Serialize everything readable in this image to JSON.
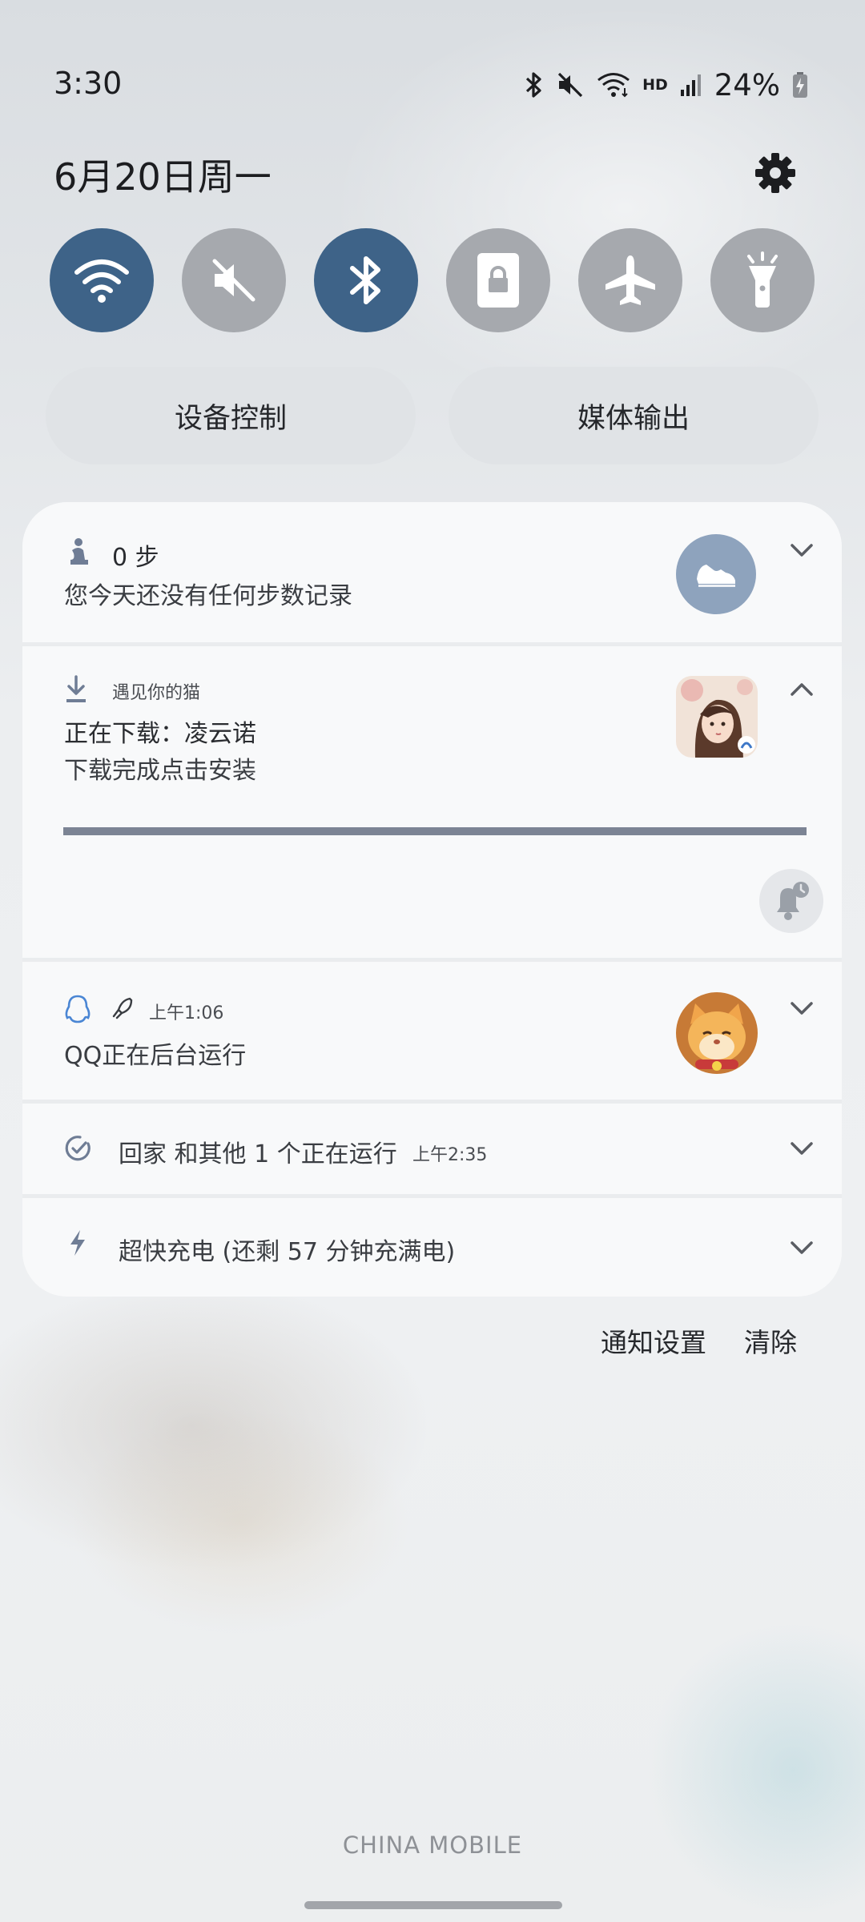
{
  "status_bar": {
    "time": "3:30",
    "hd_badge": "HD",
    "battery": "24%",
    "icons": [
      "bluetooth-icon",
      "mute-icon",
      "wifi-icon",
      "signal-icon",
      "battery-charging-icon"
    ]
  },
  "header": {
    "date": "6月20日周一",
    "settings_icon": "gear-icon"
  },
  "quick_toggles": [
    {
      "name": "wifi",
      "icon": "wifi-icon",
      "on": true
    },
    {
      "name": "sound",
      "icon": "mute-icon",
      "on": false
    },
    {
      "name": "bluetooth",
      "icon": "bluetooth-icon",
      "on": true
    },
    {
      "name": "rotation-lock",
      "icon": "lock-icon",
      "on": false
    },
    {
      "name": "airplane",
      "icon": "airplane-icon",
      "on": false
    },
    {
      "name": "flashlight",
      "icon": "flashlight-icon",
      "on": false
    }
  ],
  "pills": {
    "device_control": "设备控制",
    "media_output": "媒体输出"
  },
  "notifications": {
    "steps": {
      "title": "0 步",
      "body": "您今天还没有任何步数记录"
    },
    "download": {
      "app_name": "遇见你的猫",
      "title": "正在下载：凌云诺",
      "body": "下载完成点击安装",
      "progress": 1.0
    },
    "qq": {
      "time": "上午1:06",
      "body": "QQ正在后台运行"
    },
    "running": {
      "text": "回家 和其他 1 个正在运行",
      "time": "上午2:35"
    },
    "charging": {
      "text": "超快充电 (还剩 57 分钟充满电)"
    }
  },
  "actions": {
    "notification_settings": "通知设置",
    "clear": "清除"
  },
  "carrier": "CHINA MOBILE",
  "colors": {
    "toggle_on": "#3e6388",
    "toggle_off": "#a6a9ae",
    "progress": "#7c8494"
  }
}
